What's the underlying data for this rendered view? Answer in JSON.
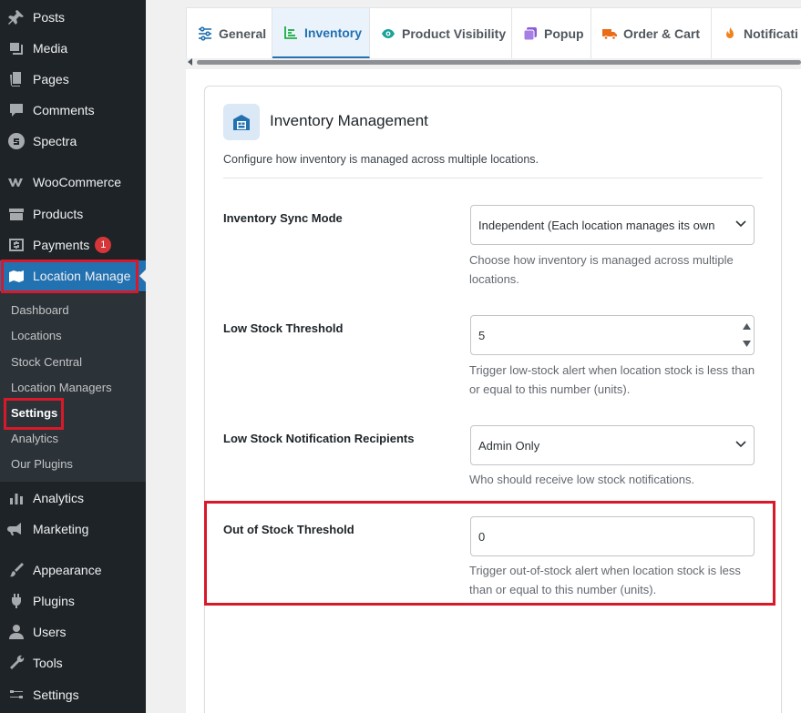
{
  "sidebar": {
    "items": [
      {
        "label": "Posts",
        "icon": "pin-icon"
      },
      {
        "label": "Media",
        "icon": "media-icon"
      },
      {
        "label": "Pages",
        "icon": "pages-icon"
      },
      {
        "label": "Comments",
        "icon": "comments-icon"
      },
      {
        "label": "Spectra",
        "icon": "spectra-icon"
      },
      {
        "label": "WooCommerce",
        "icon": "woocommerce-icon"
      },
      {
        "label": "Products",
        "icon": "products-icon"
      },
      {
        "label": "Payments",
        "icon": "payments-icon",
        "badge": "1"
      },
      {
        "label": "Location Manage",
        "icon": "location-icon"
      },
      {
        "label": "Analytics",
        "icon": "analytics-icon"
      },
      {
        "label": "Marketing",
        "icon": "marketing-icon"
      },
      {
        "label": "Appearance",
        "icon": "appearance-icon"
      },
      {
        "label": "Plugins",
        "icon": "plugins-icon"
      },
      {
        "label": "Users",
        "icon": "users-icon"
      },
      {
        "label": "Tools",
        "icon": "tools-icon"
      },
      {
        "label": "Settings",
        "icon": "settings-icon"
      }
    ],
    "submenu": [
      "Dashboard",
      "Locations",
      "Stock Central",
      "Location Managers",
      "Settings",
      "Analytics",
      "Our Plugins"
    ]
  },
  "tabs": [
    {
      "label": "General",
      "icon": "sliders-icon"
    },
    {
      "label": "Inventory",
      "icon": "chart-icon"
    },
    {
      "label": "Product Visibility",
      "icon": "eye-icon"
    },
    {
      "label": "Popup",
      "icon": "popup-icon"
    },
    {
      "label": "Order & Cart",
      "icon": "truck-icon"
    },
    {
      "label": "Notificati",
      "icon": "bell-icon"
    }
  ],
  "card": {
    "title": "Inventory Management",
    "description": "Configure how inventory is managed across multiple locations.",
    "fields": [
      {
        "label": "Inventory Sync Mode",
        "value": "Independent (Each location manages its own",
        "help": "Choose how inventory is managed across multiple locations."
      },
      {
        "label": "Low Stock Threshold",
        "value": "5",
        "help": "Trigger low-stock alert when location stock is less than or equal to this number (units)."
      },
      {
        "label": "Low Stock Notification Recipients",
        "value": "Admin Only",
        "help": "Who should receive low stock notifications."
      },
      {
        "label": "Out of Stock Threshold",
        "value": "0",
        "help": "Trigger out-of-stock alert when location stock is less than or equal to this number (units)."
      }
    ]
  },
  "colors": {
    "sidebar": "#1d2327",
    "accent": "#2271b1",
    "highlight": "#d7192a",
    "badge": "#d63638"
  }
}
